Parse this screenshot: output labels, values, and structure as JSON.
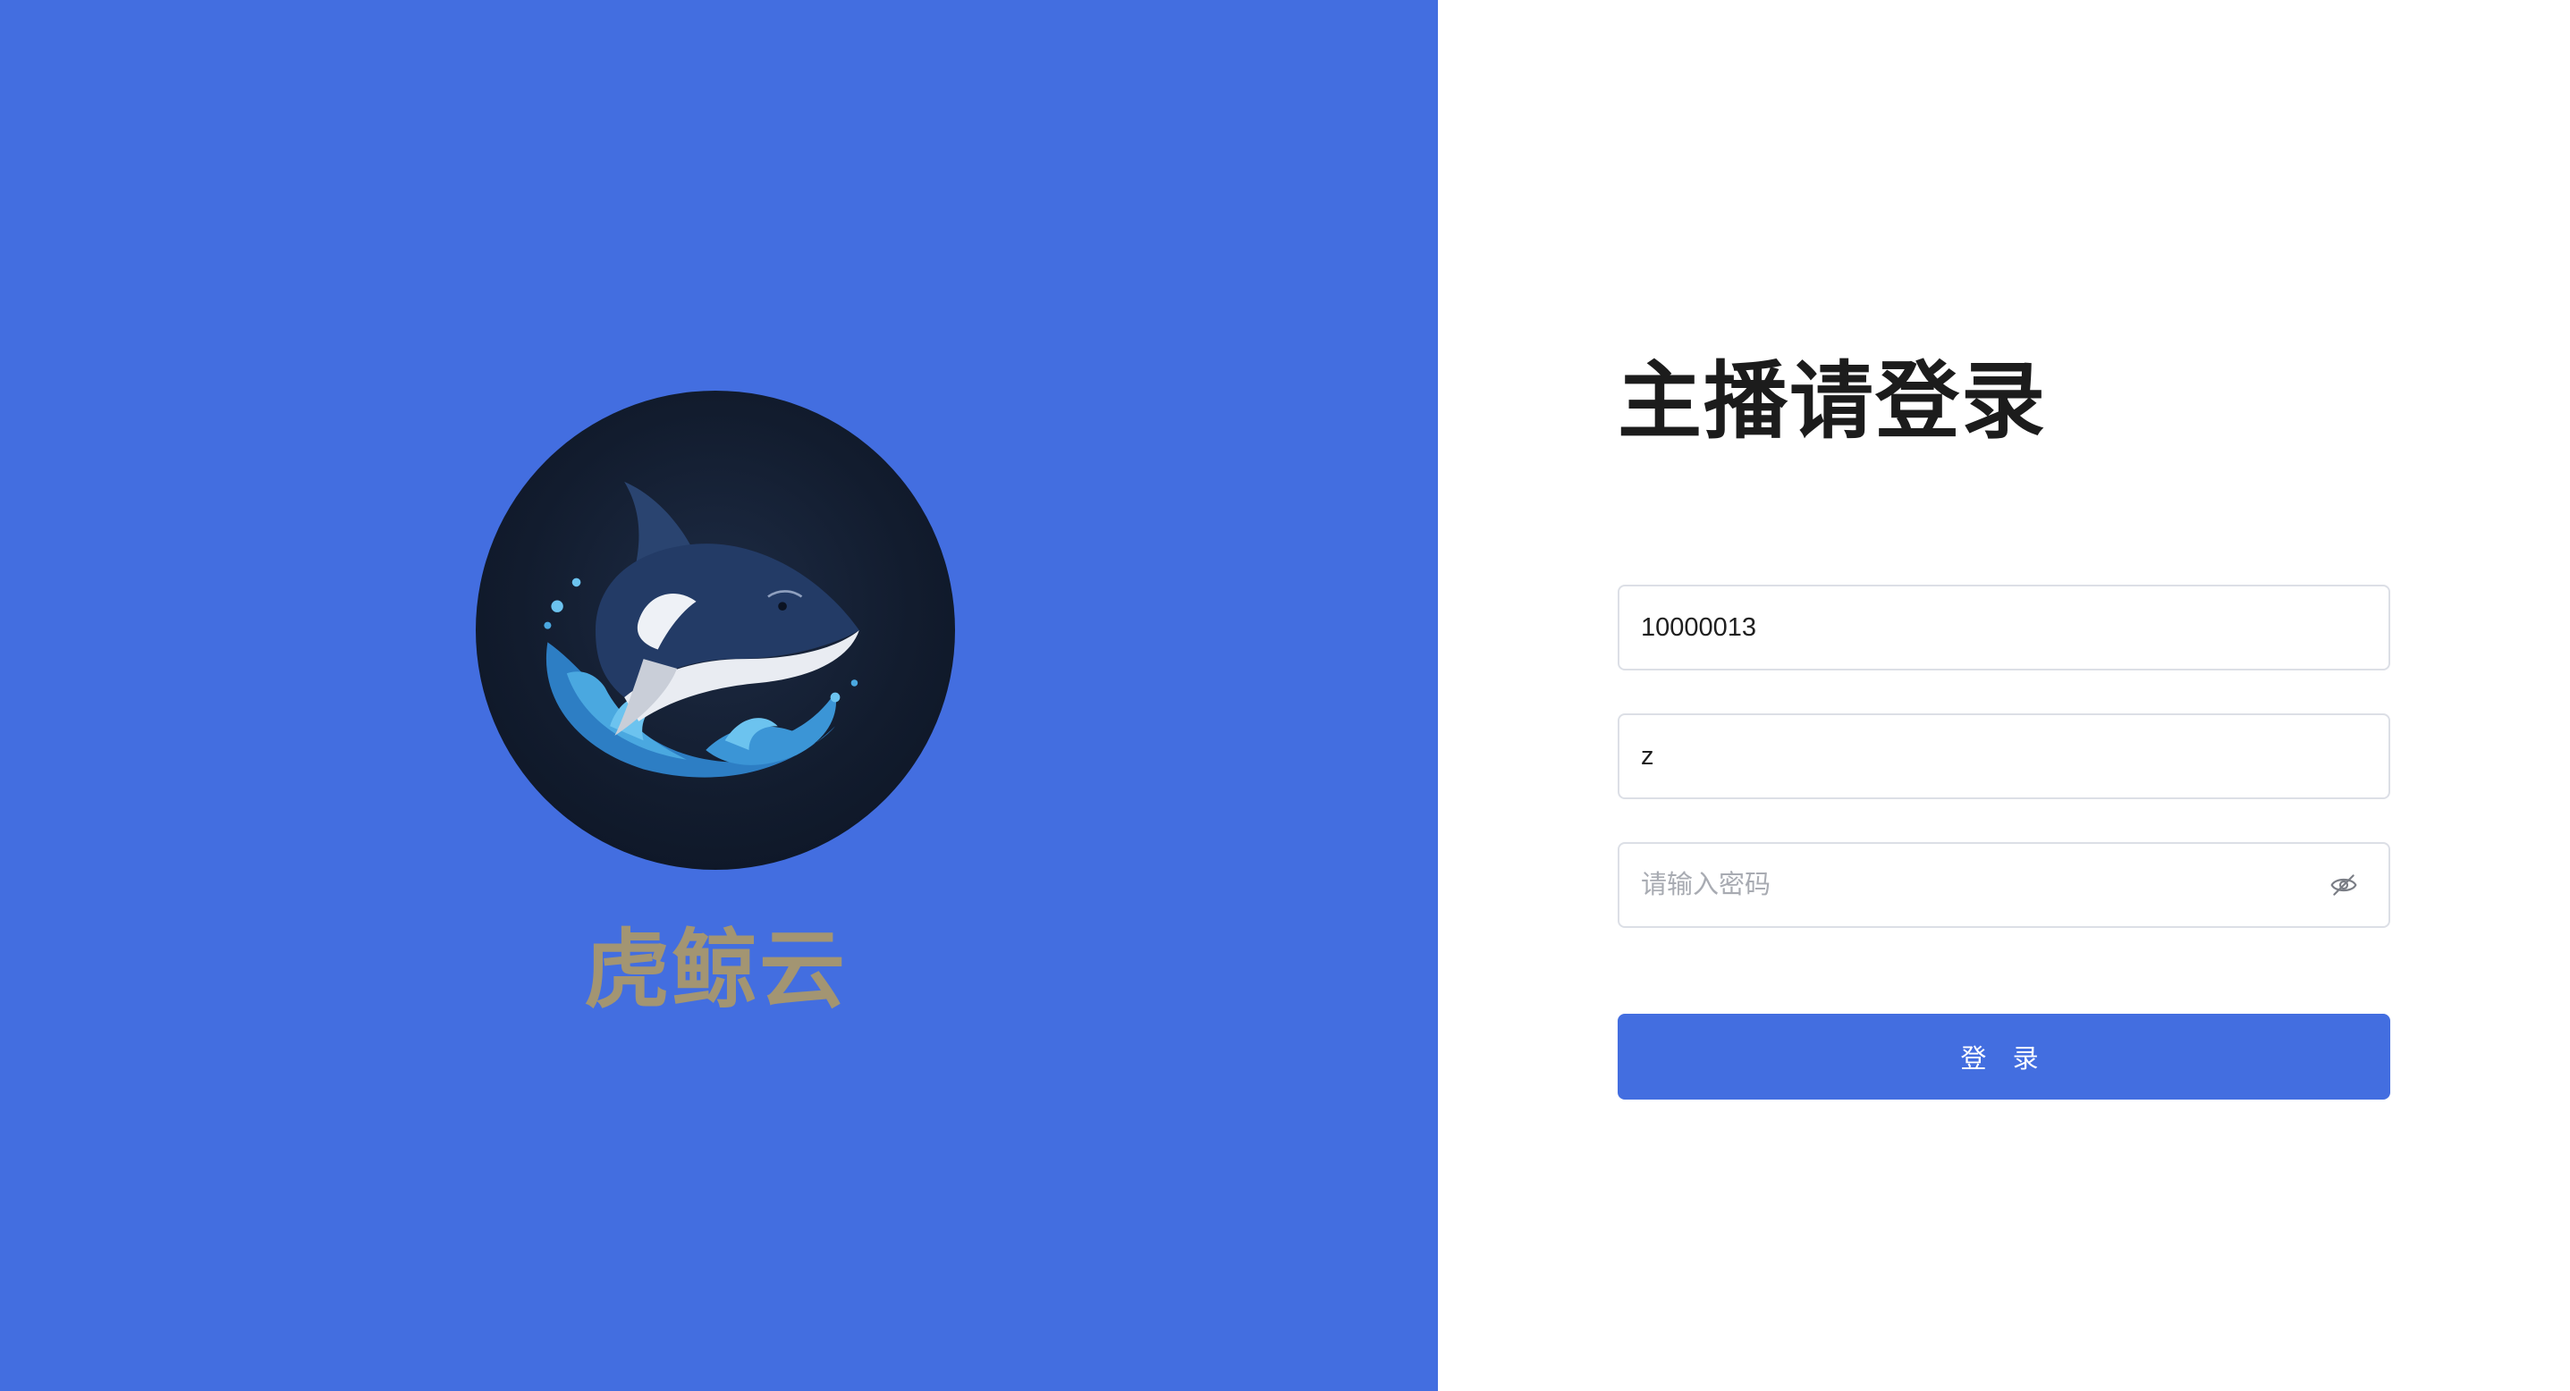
{
  "colors": {
    "brand_panel_bg": "#436ee0",
    "brand_name": "#a39572",
    "primary_button": "#436ee0"
  },
  "brand": {
    "name": "虎鲸云",
    "logo_icon": "orca-whale-logo"
  },
  "login": {
    "title": "主播请登录",
    "account": {
      "value": "10000013",
      "placeholder": ""
    },
    "name": {
      "value": "z",
      "placeholder": ""
    },
    "password": {
      "value": "",
      "placeholder": "请输入密码",
      "toggle_icon": "eye-off-icon"
    },
    "submit_label": "登 录"
  }
}
